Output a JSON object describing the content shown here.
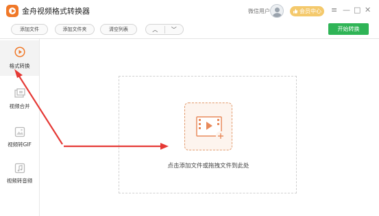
{
  "app": {
    "title": "金舟视频格式转换器",
    "user_label": "微信用户",
    "member_label": "会员中心",
    "window_controls": [
      "≡",
      "—",
      "□",
      "✕"
    ]
  },
  "toolbar": {
    "add_file": "添加文件",
    "add_folder": "添加文件夹",
    "clear_list": "清空列表",
    "up_glyph": "︿",
    "down_glyph": "﹀",
    "start": "开始转换"
  },
  "sidebar": {
    "items": [
      {
        "label": "格式转换",
        "icon": "format-convert-icon",
        "active": true
      },
      {
        "label": "视频合并",
        "icon": "video-merge-icon",
        "active": false
      },
      {
        "label": "视频转GIF",
        "icon": "gif-icon",
        "active": false
      },
      {
        "label": "视频转音频",
        "icon": "music-icon",
        "active": false
      }
    ]
  },
  "main": {
    "drop_hint": "点击添加文件或拖拽文件到此处"
  },
  "colors": {
    "accent": "#f07828",
    "start_button": "#2fb456",
    "member": "#f4c96c",
    "annotation_arrow": "#e53935"
  }
}
